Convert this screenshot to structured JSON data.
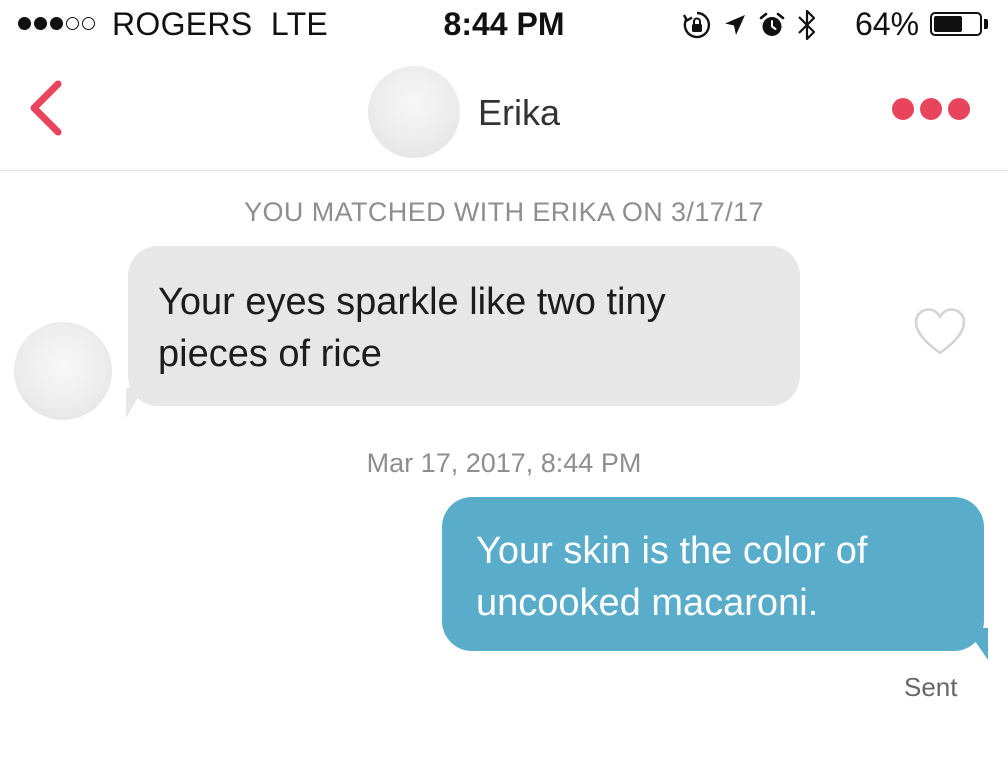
{
  "status_bar": {
    "signal_filled": 3,
    "signal_total": 5,
    "carrier": "ROGERS  LTE",
    "time": "8:44 PM",
    "battery_percent": "64%",
    "battery_level": 0.64,
    "icons": [
      "rotation-lock-icon",
      "location-arrow-icon",
      "alarm-clock-icon",
      "bluetooth-icon"
    ]
  },
  "header": {
    "back_icon": "chevron-left-icon",
    "contact_name": "Erika",
    "menu_icon": "more-dots-icon",
    "accent_color": "#e8455d"
  },
  "conversation": {
    "match_banner": "YOU MATCHED WITH ERIKA ON 3/17/17",
    "messages": [
      {
        "direction": "incoming",
        "text": "Your eyes sparkle like two tiny pieces of rice",
        "bubble_color": "#e7e7e7"
      },
      {
        "direction": "outgoing",
        "text": "Your skin is the color of uncooked macaroni.",
        "bubble_color": "#5aadca",
        "status": "Sent"
      }
    ],
    "timestamp": "Mar 17, 2017, 8:44 PM",
    "like_icon": "heart-outline-icon"
  }
}
